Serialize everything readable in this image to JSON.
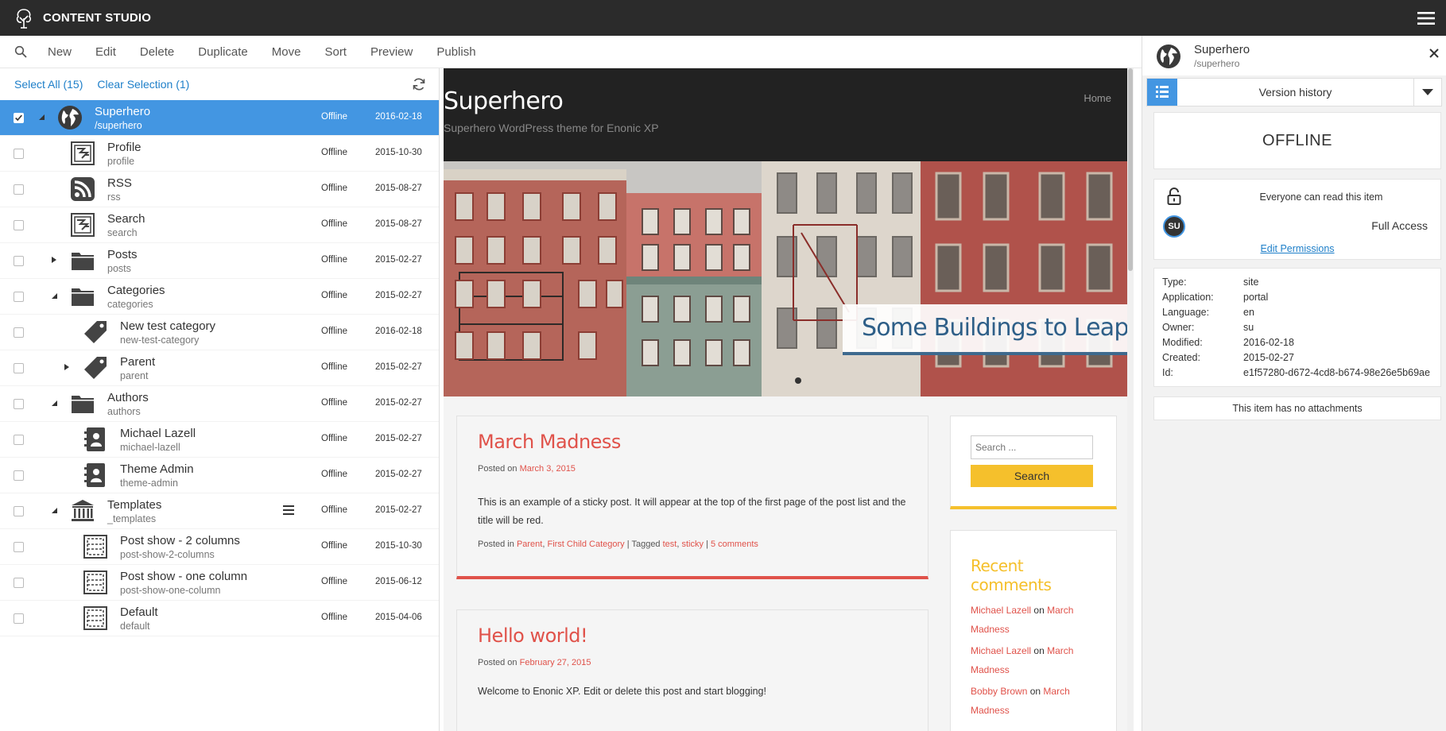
{
  "app": {
    "title": "CONTENT STUDIO"
  },
  "toolbar": {
    "buttons": [
      "New",
      "Edit",
      "Delete",
      "Duplicate",
      "Move",
      "Sort",
      "Preview",
      "Publish"
    ]
  },
  "selection": {
    "select_all": "Select All (15)",
    "clear_selection": "Clear Selection (1)"
  },
  "tree": [
    {
      "name": "Superhero",
      "path": "/superhero",
      "status": "Offline",
      "date": "2016-02-18",
      "icon": "globe-icon",
      "level": 0,
      "toggle": "collapse",
      "selected": true
    },
    {
      "name": "Profile",
      "path": "profile",
      "status": "Offline",
      "date": "2015-10-30",
      "icon": "page-template-icon",
      "level": 1,
      "toggle": "none",
      "selected": false
    },
    {
      "name": "RSS",
      "path": "rss",
      "status": "Offline",
      "date": "2015-08-27",
      "icon": "rss-icon",
      "level": 1,
      "toggle": "none",
      "selected": false
    },
    {
      "name": "Search",
      "path": "search",
      "status": "Offline",
      "date": "2015-08-27",
      "icon": "page-template-icon",
      "level": 1,
      "toggle": "none",
      "selected": false
    },
    {
      "name": "Posts",
      "path": "posts",
      "status": "Offline",
      "date": "2015-02-27",
      "icon": "folder-icon",
      "level": 1,
      "toggle": "expand",
      "selected": false
    },
    {
      "name": "Categories",
      "path": "categories",
      "status": "Offline",
      "date": "2015-02-27",
      "icon": "folder-icon",
      "level": 1,
      "toggle": "collapse",
      "selected": false
    },
    {
      "name": "New test category",
      "path": "new-test-category",
      "status": "Offline",
      "date": "2016-02-18",
      "icon": "tag-icon",
      "level": 2,
      "toggle": "none",
      "selected": false
    },
    {
      "name": "Parent",
      "path": "parent",
      "status": "Offline",
      "date": "2015-02-27",
      "icon": "tag-icon",
      "level": 2,
      "toggle": "expand",
      "selected": false
    },
    {
      "name": "Authors",
      "path": "authors",
      "status": "Offline",
      "date": "2015-02-27",
      "icon": "folder-icon",
      "level": 1,
      "toggle": "collapse",
      "selected": false
    },
    {
      "name": "Michael Lazell",
      "path": "michael-lazell",
      "status": "Offline",
      "date": "2015-02-27",
      "icon": "contact-icon",
      "level": 2,
      "toggle": "none",
      "selected": false
    },
    {
      "name": "Theme Admin",
      "path": "theme-admin",
      "status": "Offline",
      "date": "2015-02-27",
      "icon": "contact-icon",
      "level": 2,
      "toggle": "none",
      "selected": false
    },
    {
      "name": "Templates",
      "path": "_templates",
      "status": "Offline",
      "date": "2015-02-27",
      "icon": "templates-icon",
      "level": 1,
      "toggle": "collapse",
      "selected": false,
      "menu": true
    },
    {
      "name": "Post show - 2 columns",
      "path": "post-show-2-columns",
      "status": "Offline",
      "date": "2015-10-30",
      "icon": "layout-template-icon",
      "level": 2,
      "toggle": "none",
      "selected": false
    },
    {
      "name": "Post show - one column",
      "path": "post-show-one-column",
      "status": "Offline",
      "date": "2015-06-12",
      "icon": "layout-template-icon",
      "level": 2,
      "toggle": "none",
      "selected": false
    },
    {
      "name": "Default",
      "path": "default",
      "status": "Offline",
      "date": "2015-04-06",
      "icon": "layout-template-icon",
      "level": 2,
      "toggle": "none",
      "selected": false
    }
  ],
  "preview": {
    "site_title": "Superhero",
    "site_tagline": "Superhero WordPress theme for Enonic XP",
    "nav_home": "Home",
    "hero_caption": "Some Buildings to Leap",
    "posts": [
      {
        "title": "March Madness",
        "posted_on": "Posted on",
        "date": "March 3, 2015",
        "body": "This is an example of a sticky post. It will appear at the top of the first page of the post list and the title will be red.",
        "posted_in": "Posted in",
        "cat1": "Parent",
        "cat2": "First Child Category",
        "tagged": "| Tagged",
        "tag1": "test",
        "tag2": "sticky",
        "comments": "5 comments"
      },
      {
        "title": "Hello world!",
        "posted_on": "Posted on",
        "date": "February 27, 2015",
        "body": "Welcome to Enonic XP. Edit or delete this post and start blogging!"
      }
    ],
    "search_placeholder": "Search ...",
    "search_button": "Search",
    "recent_comments_title": "Recent comments",
    "recent_comments": [
      {
        "author": "Michael Lazell",
        "on": "on",
        "post": "March Madness"
      },
      {
        "author": "Michael Lazell",
        "on": "on",
        "post": "March Madness"
      },
      {
        "author": "Bobby Brown",
        "on": "on",
        "post": "March Madness"
      }
    ]
  },
  "details": {
    "name": "Superhero",
    "path": "/superhero",
    "widget": "Version history",
    "status": "OFFLINE",
    "everyone": "Everyone can read this item",
    "avatar": "SU",
    "access": "Full Access",
    "edit_permissions": "Edit Permissions",
    "properties": [
      {
        "key": "Type:",
        "value": "site"
      },
      {
        "key": "Application:",
        "value": "portal"
      },
      {
        "key": "Language:",
        "value": "en"
      },
      {
        "key": "Owner:",
        "value": "su"
      },
      {
        "key": "Modified:",
        "value": "2016-02-18"
      },
      {
        "key": "Created:",
        "value": "2015-02-27"
      },
      {
        "key": "Id:",
        "value": "e1f57280-d672-4cd8-b674-98e26e5b69ae"
      }
    ],
    "attachments": "This item has no attachments"
  },
  "colors": {
    "accent": "#4396e2",
    "post_title": "#e0524a",
    "widget_yellow": "#f5c02c",
    "topbar": "#2b2b2b"
  }
}
